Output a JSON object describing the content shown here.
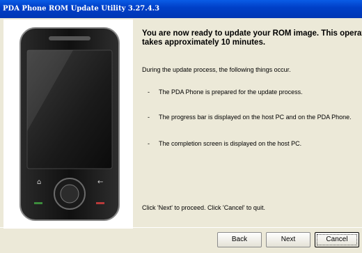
{
  "window": {
    "title": "PDA Phone ROM Update Utility 3.27.4.3"
  },
  "content": {
    "heading_line1": "You are now ready to update your ROM image. This operation",
    "heading_line2": "takes approximately 10 minutes.",
    "intro": "During the update process, the following things occur.",
    "bullets": [
      "The PDA Phone is prepared for the update process.",
      "The progress bar is displayed on the host PC and on the PDA Phone.",
      "The completion screen is displayed on the host PC."
    ],
    "bullet_marker": "-",
    "instruction": "Click 'Next' to proceed. Click 'Cancel' to quit."
  },
  "buttons": {
    "back": "Back",
    "next": "Next",
    "cancel": "Cancel"
  },
  "colors": {
    "dialog_bg": "#ECE9D8",
    "titlebar": "#0040C8"
  }
}
